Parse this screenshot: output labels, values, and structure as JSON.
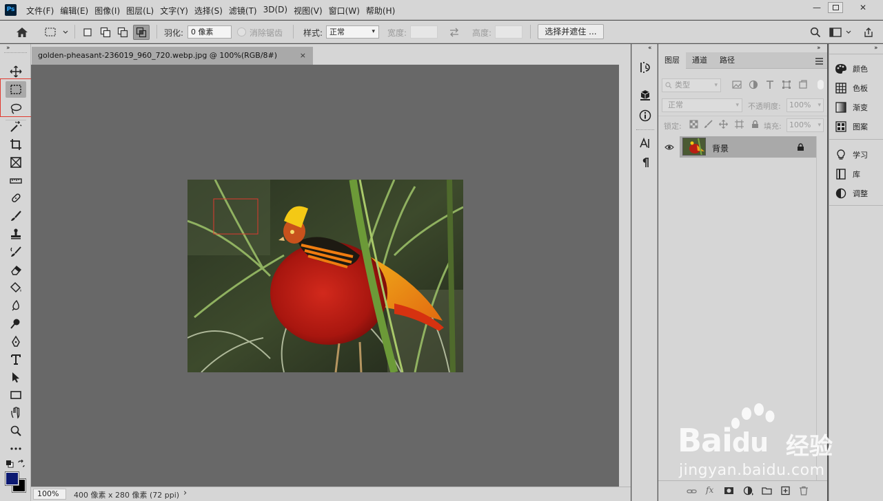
{
  "app": {
    "logo_text": "Ps"
  },
  "menu": [
    "文件(F)",
    "编辑(E)",
    "图像(I)",
    "图层(L)",
    "文字(Y)",
    "选择(S)",
    "滤镜(T)",
    "3D(D)",
    "视图(V)",
    "窗口(W)",
    "帮助(H)"
  ],
  "window_controls": {
    "minimize": "—",
    "maximize": "□",
    "close": "✕"
  },
  "options": {
    "feather_label": "羽化:",
    "feather_value": "0 像素",
    "antialias_label": "消除锯齿",
    "style_label": "样式:",
    "style_value": "正常",
    "width_label": "宽度:",
    "height_label": "高度:",
    "select_mask_button": "选择并遮住 ..."
  },
  "document": {
    "tab_title": "golden-pheasant-236019_960_720.webp.jpg @ 100%(RGB/8#)",
    "tab_close": "×",
    "zoom": "100%",
    "info": "400 像素 x 280 像素 (72 ppi)",
    "status_arrow": "›"
  },
  "layers_panel": {
    "tabs": [
      "图层",
      "通道",
      "路径"
    ],
    "active_tab": 0,
    "filter_kind": "类型",
    "blend_mode": "正常",
    "opacity_label": "不透明度:",
    "opacity_value": "100%",
    "lock_label": "锁定:",
    "fill_label": "填充:",
    "fill_value": "100%",
    "layers": [
      {
        "name": "背景",
        "visible": true,
        "locked": true
      }
    ]
  },
  "right_panel": {
    "group1": [
      "颜色",
      "色板",
      "渐变",
      "图案"
    ],
    "group2": [
      "学习",
      "库",
      "调整"
    ]
  },
  "watermark": {
    "brand": "Bai",
    "brand2": "du",
    "suffix": "经验",
    "url": "jingyan.baidu.com"
  },
  "colors": {
    "foreground": "#0d1a72",
    "background": "#000000",
    "highlight_box": "#e0392f",
    "ui_light": "#d6d6d6",
    "canvas": "#686868"
  }
}
